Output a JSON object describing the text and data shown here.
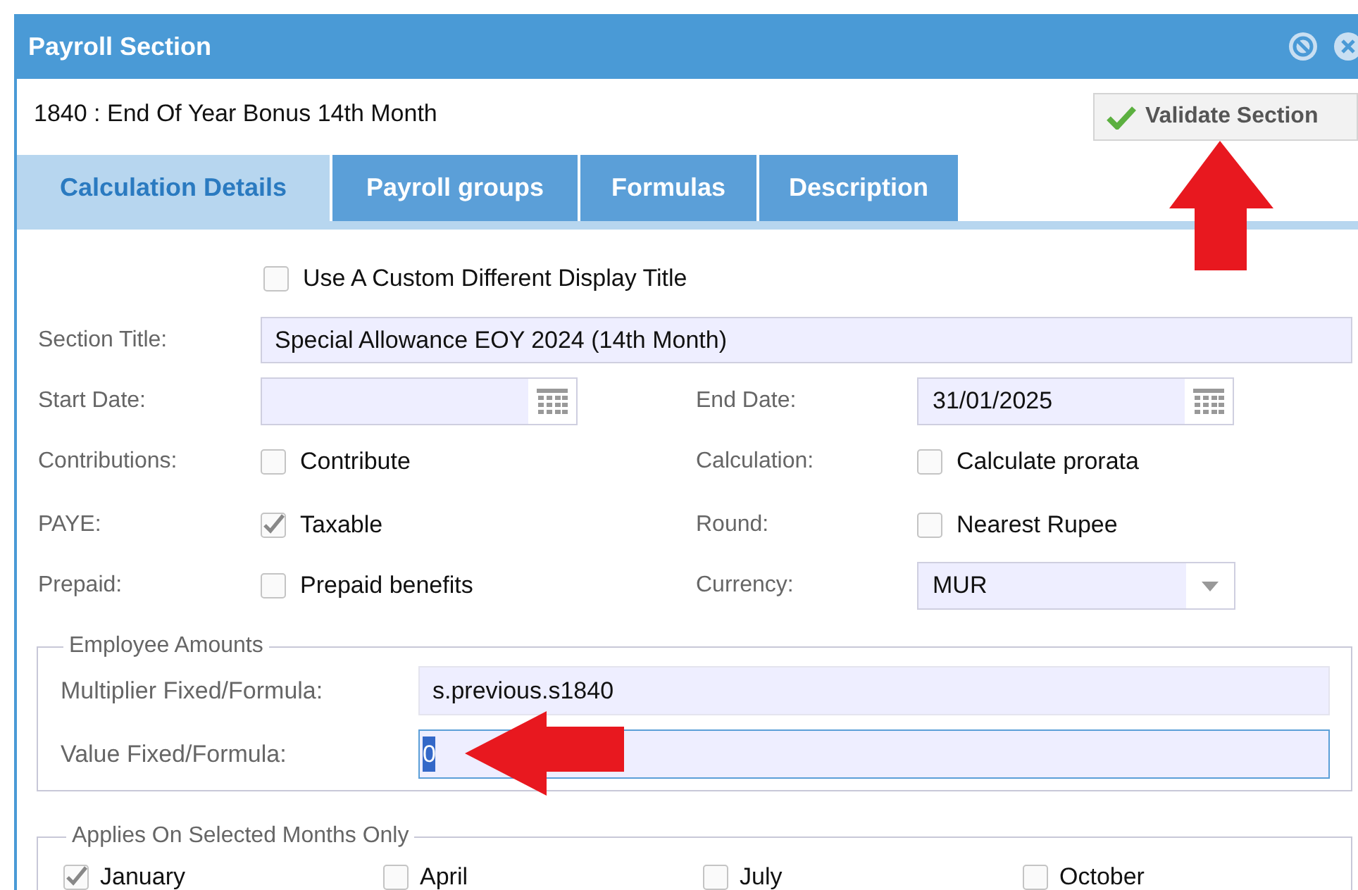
{
  "window": {
    "title": "Payroll Section"
  },
  "header": {
    "title": "1840 : End Of Year Bonus 14th Month",
    "validate_button": "Validate Section"
  },
  "tabs": [
    {
      "label": "Calculation Details",
      "selected": true
    },
    {
      "label": "Payroll groups",
      "selected": false
    },
    {
      "label": "Formulas",
      "selected": false
    },
    {
      "label": "Description",
      "selected": false
    }
  ],
  "custom_title": {
    "label": "Use A Custom Different Display Title",
    "checked": false
  },
  "section_title": {
    "label": "Section Title:",
    "value": "Special Allowance EOY 2024 (14th Month)"
  },
  "rows": [
    [
      {
        "kind": "date",
        "label": "Start Date:"
      },
      {
        "kind": "date",
        "label": "End Date:",
        "value": "31/01/2025"
      }
    ],
    [
      {
        "kind": "checkbox",
        "label": "Contributions:",
        "option": "Contribute",
        "checked": false
      },
      {
        "kind": "checkbox",
        "label": "Calculation:",
        "option": "Calculate prorata",
        "checked": false
      }
    ],
    [
      {
        "kind": "checkbox",
        "label": "PAYE:",
        "option": "Taxable",
        "checked": true
      },
      {
        "kind": "checkbox",
        "label": "Round:",
        "option": "Nearest Rupee",
        "checked": false
      }
    ],
    [
      {
        "kind": "checkbox",
        "label": "Prepaid:",
        "option": "Prepaid benefits",
        "checked": false
      },
      {
        "kind": "select",
        "label": "Currency:",
        "value": "MUR"
      }
    ]
  ],
  "employee_amounts": {
    "legend": "Employee Amounts",
    "fields": [
      {
        "label": "Multiplier Fixed/Formula:",
        "value": "s.previous.s1840",
        "focused": false
      },
      {
        "label": "Value Fixed/Formula:",
        "value": "0",
        "focused": true
      }
    ]
  },
  "months_section": {
    "legend": "Applies On Selected Months Only",
    "months": [
      {
        "label": "January",
        "checked": true
      },
      {
        "label": "April",
        "checked": false
      },
      {
        "label": "July",
        "checked": false
      },
      {
        "label": "October",
        "checked": false
      }
    ]
  }
}
